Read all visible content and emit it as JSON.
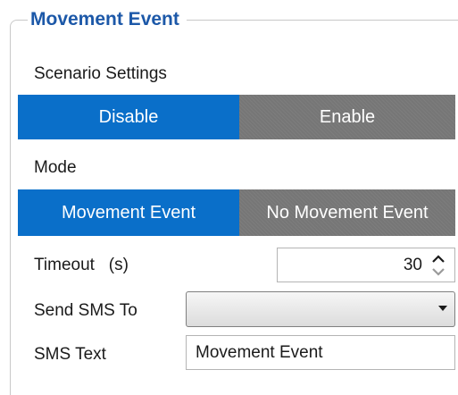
{
  "group": {
    "title": "Movement Event"
  },
  "scenario": {
    "label": "Scenario Settings",
    "options": [
      "Disable",
      "Enable"
    ],
    "selected": "Disable"
  },
  "mode": {
    "label": "Mode",
    "options": [
      "Movement Event",
      "No Movement Event"
    ],
    "selected": "Movement Event"
  },
  "timeout": {
    "label": "Timeout   (s)",
    "value": "30"
  },
  "send_sms": {
    "label": "Send SMS To",
    "value": ""
  },
  "sms_text": {
    "label": "SMS Text",
    "value": "Movement Event"
  },
  "colors": {
    "title": "#1c58a8",
    "active_segment": "#0a6fc9",
    "inactive_segment": "#767676"
  },
  "icons": {
    "spinner": "up-down-arrows-icon",
    "dropdown": "chevron-down-icon"
  }
}
